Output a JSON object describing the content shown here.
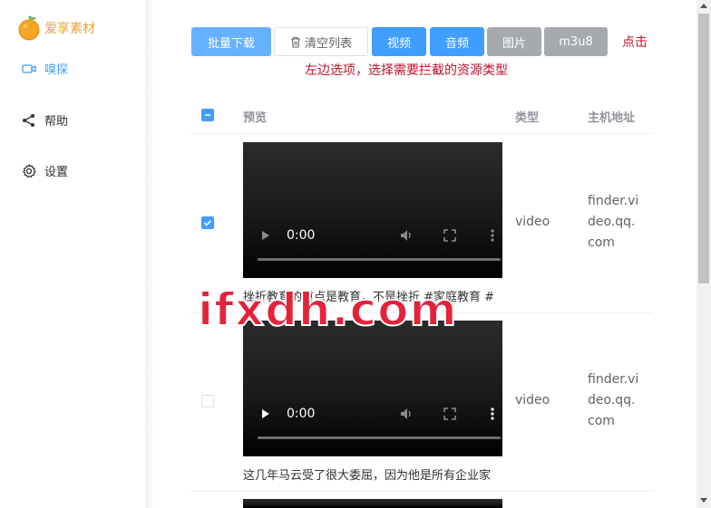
{
  "sidebar": {
    "logo_text": "爱享素材",
    "items": [
      {
        "label": "嗅探",
        "icon": "video-camera-icon"
      },
      {
        "label": "帮助",
        "icon": "share-icon"
      },
      {
        "label": "设置",
        "icon": "gear-icon"
      }
    ]
  },
  "toolbar": {
    "batch_download": "批量下载",
    "clear_list": "清空列表",
    "video": "视频",
    "audio": "音频",
    "image": "图片",
    "m3u8": "m3u8",
    "hint_click": "点击",
    "hint_line": "左边选项，选择需要拦截的资源类型"
  },
  "table": {
    "headers": {
      "preview": "预览",
      "type": "类型",
      "host": "主机地址"
    },
    "rows": [
      {
        "checked": true,
        "video_time": "0:00",
        "type": "video",
        "host": [
          "finder.vi",
          "deo.qq.",
          "com"
        ],
        "caption": "挫折教育的重点是教育，不是挫折 #家庭教育 #"
      },
      {
        "checked": false,
        "video_time": "0:00",
        "type": "video",
        "host": [
          "finder.vi",
          "deo.qq.",
          "com"
        ],
        "caption": "这几年马云受了很大委屈，因为他是所有企业家"
      }
    ]
  },
  "watermark": "ifxdh.com",
  "colors": {
    "accent": "#409eff",
    "accent_light": "#66b1ff",
    "gray_button": "#a6a9ad",
    "hint_red": "#c0112b",
    "watermark_red": "#e6213a"
  }
}
